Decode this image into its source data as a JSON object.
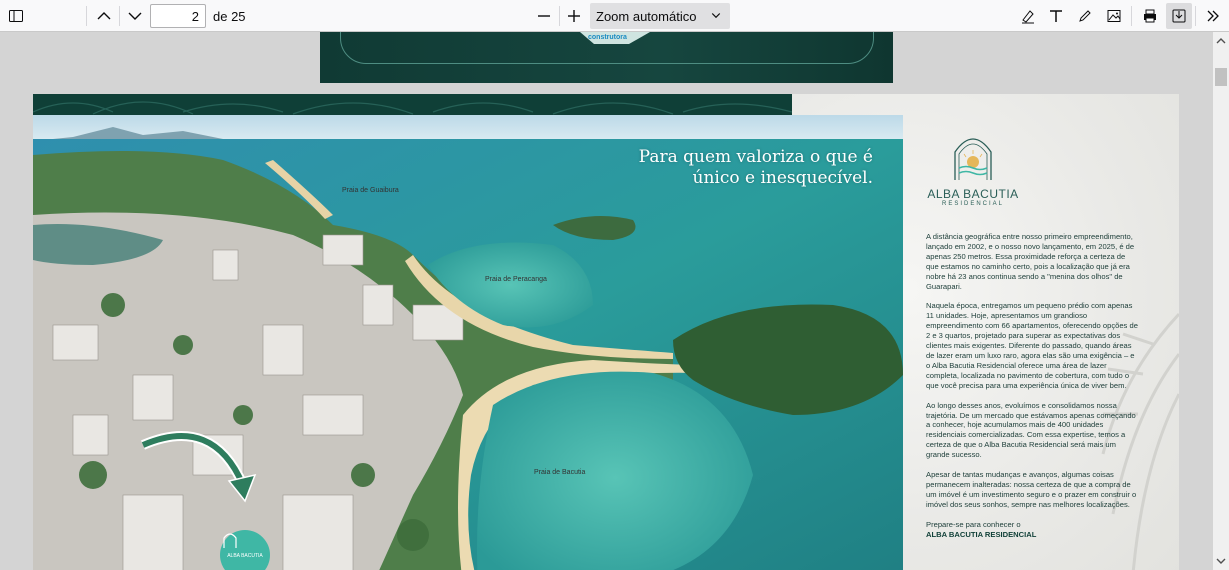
{
  "toolbar": {
    "page_number": "2",
    "page_total": "de 25",
    "zoom_label": "Zoom automático",
    "icons": [
      "sidebar-toggle-icon",
      "arrow-up-icon",
      "arrow-down-icon",
      "minus-icon",
      "plus-icon",
      "chevron-down-icon",
      "highlight-icon",
      "text-icon",
      "draw-icon",
      "image-icon",
      "print-icon",
      "save-icon",
      "more-tools-icon"
    ]
  },
  "page1": {
    "brand_tag": "construtora"
  },
  "page2": {
    "headline_line1": "Para quem valoriza o que é",
    "headline_line2": "único e inesquecível.",
    "beach_labels": [
      "Praia de Guaibura",
      "Praia de Peracanga",
      "Praia de Bacutia"
    ],
    "logo_name": "ALBA BACUTIA",
    "logo_sub": "RESIDENCIAL",
    "badge_text": "ALBA BACUTIA",
    "paragraphs": [
      "A distância geográfica entre nosso primeiro empreendimento, lançado em 2002, e o nosso novo lançamento, em 2025, é de apenas 250 metros. Essa proximidade reforça a certeza de que estamos no caminho certo, pois a localização que já era nobre há 23 anos continua sendo a \"menina dos olhos\" de Guarapari.",
      "Naquela época, entregamos um pequeno prédio com apenas 11 unidades. Hoje, apresentamos um grandioso empreendimento com 66 apartamentos, oferecendo opções de 2 e 3 quartos, projetado para superar as expectativas dos clientes mais exigentes. Diferente do passado, quando áreas de lazer eram um luxo raro, agora elas são uma exigência – e o Alba Bacutia Residencial oferece uma área de lazer completa, localizada no pavimento de cobertura, com tudo o que você precisa para uma experiência única de viver bem.",
      "Ao longo desses anos, evoluímos e consolidamos nossa trajetória. De um mercado que estávamos apenas começando a conhecer, hoje acumulamos mais de 400 unidades residenciais comercializadas. Com essa expertise, temos a certeza de que o Alba Bacutia Residencial será mais um grande sucesso.",
      "Apesar de tantas mudanças e avanços, algumas coisas permanecem inalteradas: nossa certeza de que a compra de um imóvel é um investimento seguro e o prazer em construir o imóvel dos seus sonhos, sempre nas melhores localizações."
    ],
    "cta_line": "Prepare-se para conhecer o",
    "cta_strong": "ALBA BACUTIA RESIDENCIAL"
  },
  "colors": {
    "brand_green": "#0f3f37",
    "teal_badge": "#3fb7a5",
    "sea": "#2f9c9b"
  }
}
